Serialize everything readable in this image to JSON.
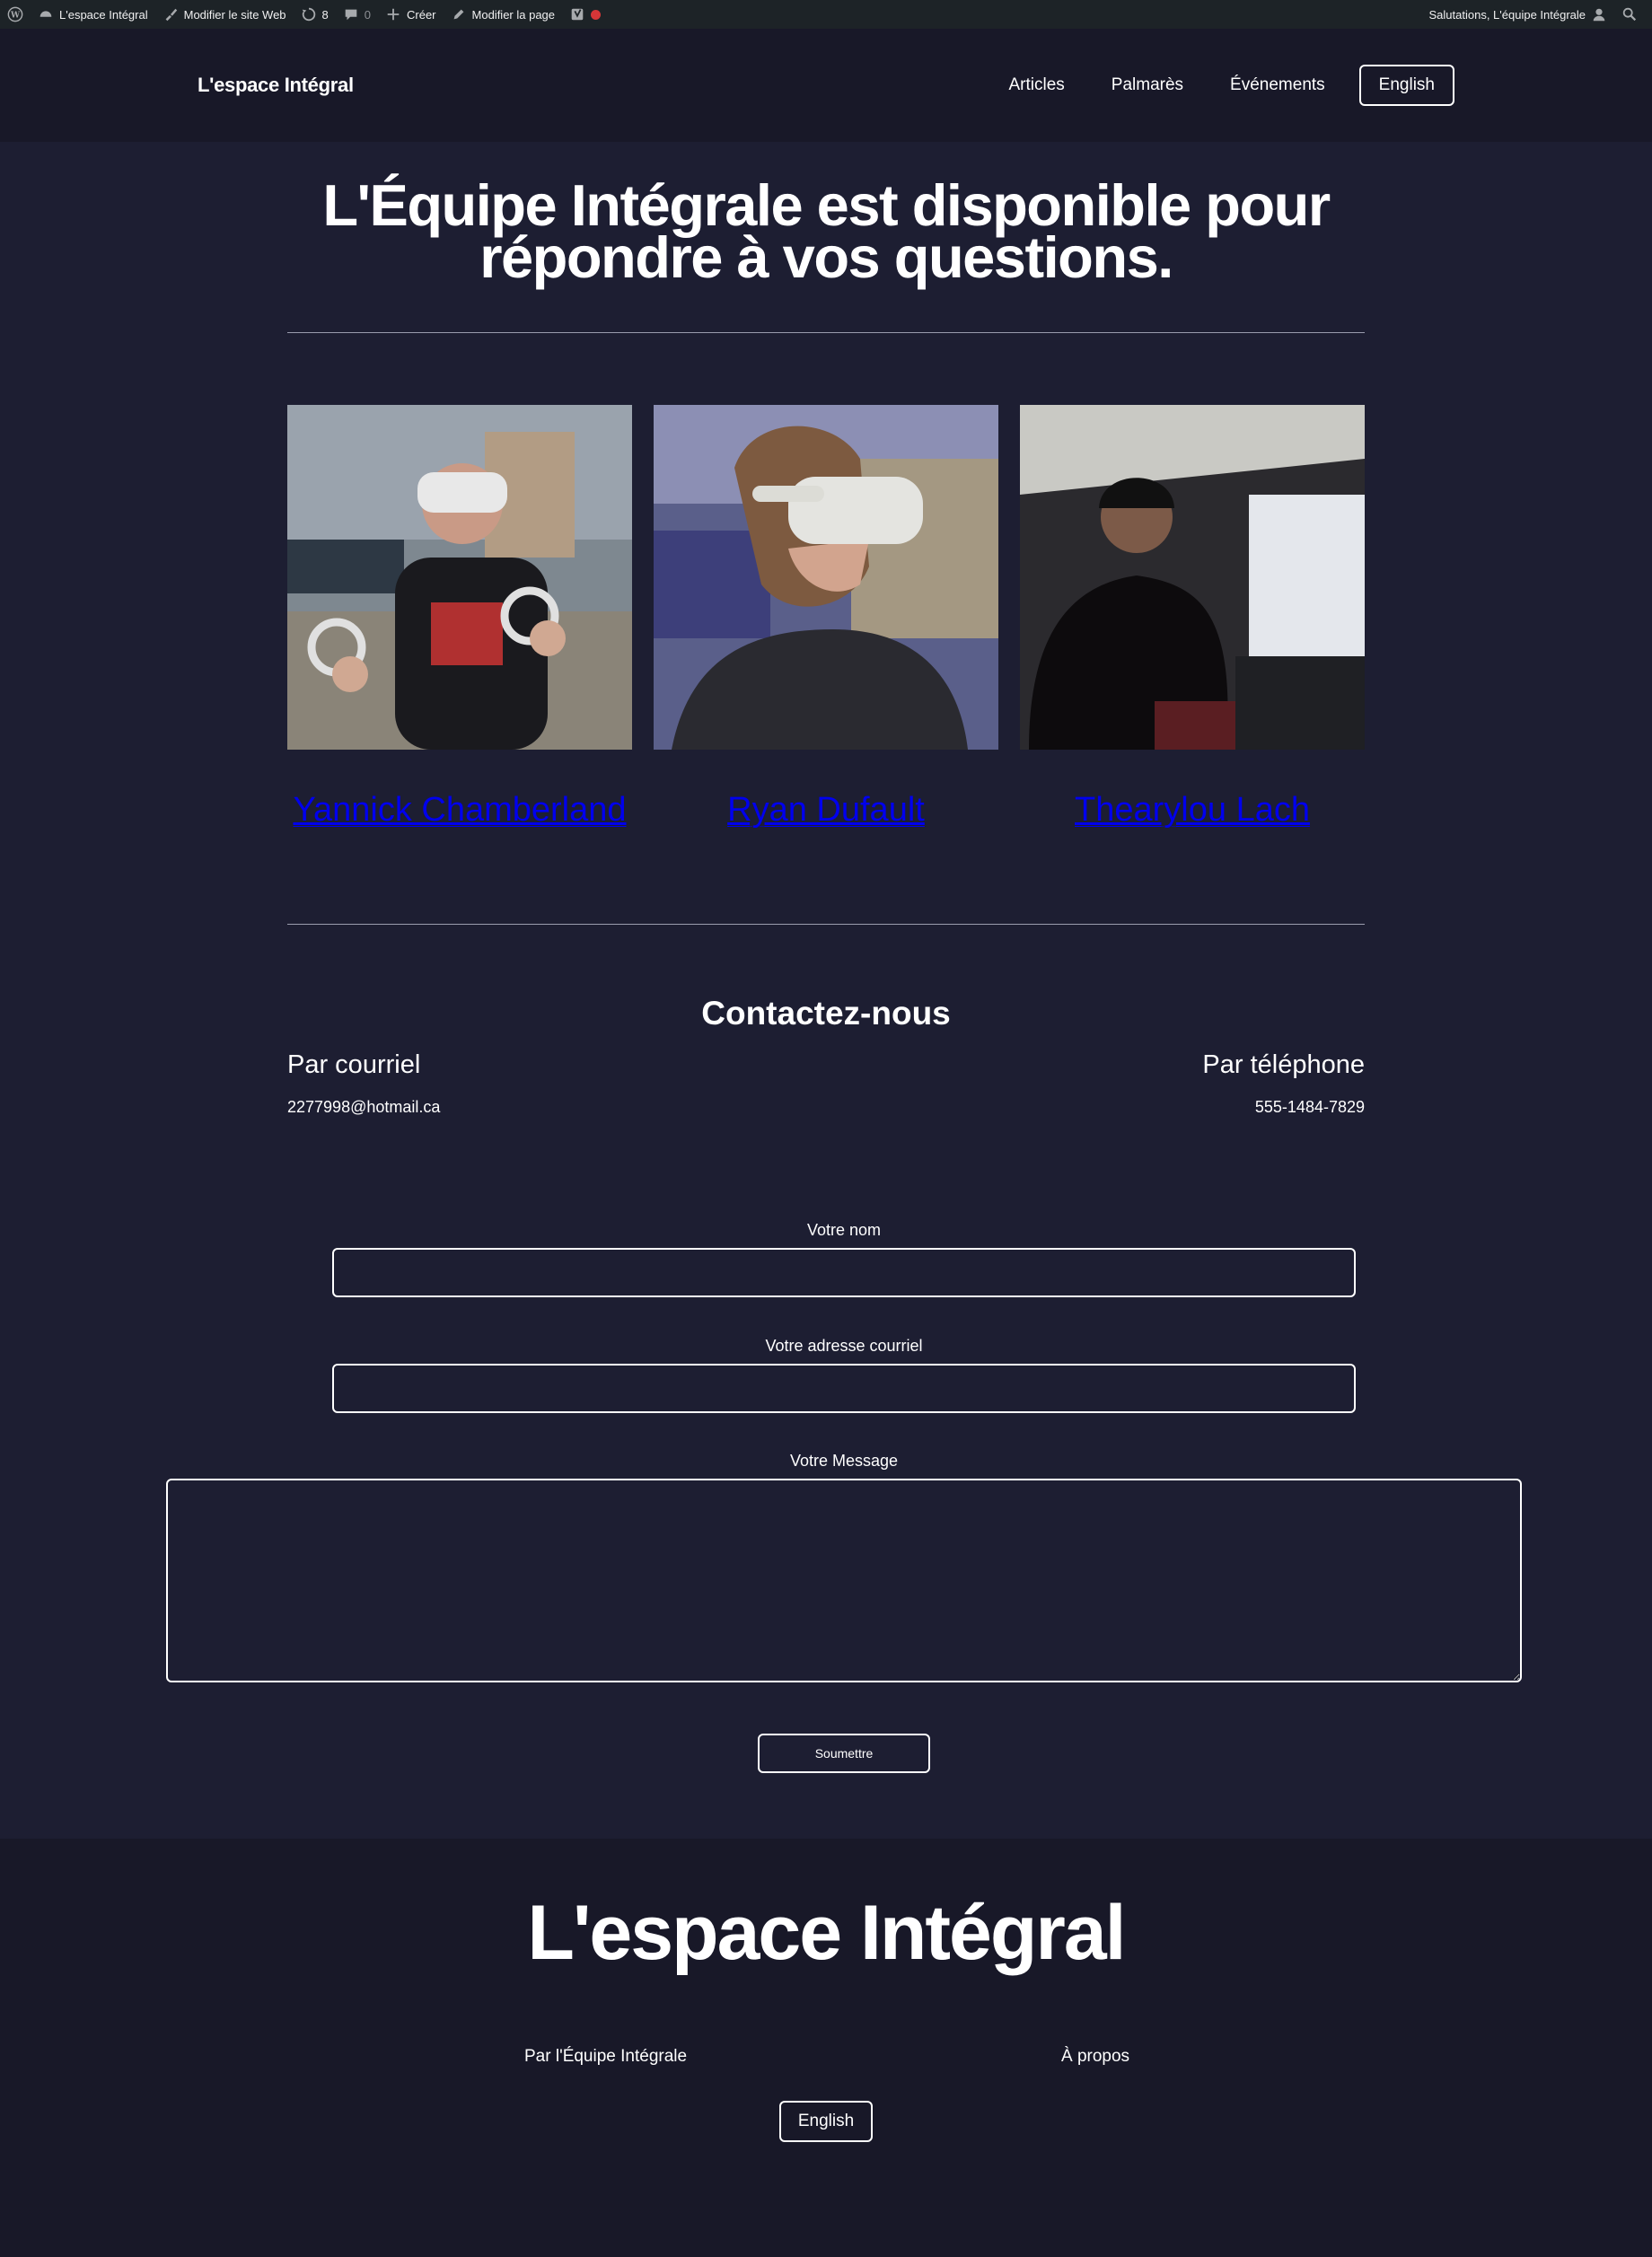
{
  "admin_bar": {
    "site_name": "L'espace Intégral",
    "edit_site": "Modifier le site Web",
    "updates_count": "8",
    "comments_count": "0",
    "create": "Créer",
    "edit_page": "Modifier la page",
    "greeting": "Salutations, L'équipe Intégrale"
  },
  "header": {
    "brand": "L'espace Intégral",
    "nav": [
      "Articles",
      "Palmarès",
      "Événements"
    ],
    "language_button": "English"
  },
  "hero": {
    "title": "L'Équipe Intégrale est disponible pour répondre à vos questions."
  },
  "team": [
    {
      "name": "Yannick Chamberland",
      "photo": "person-vr-headset-controllers"
    },
    {
      "name": "Ryan Dufault",
      "photo": "person-vr-headset-profile"
    },
    {
      "name": "Thearylou Lach",
      "photo": "person-dark-room"
    }
  ],
  "contact": {
    "title": "Contactez-nous",
    "email_heading": "Par courriel",
    "email": "2277998@hotmail.ca",
    "phone_heading": "Par téléphone",
    "phone": "555-1484-7829"
  },
  "form": {
    "name_label": "Votre nom",
    "email_label": "Votre adresse courriel",
    "message_label": "Votre Message",
    "submit": "Soumettre"
  },
  "footer": {
    "brand": "L'espace Intégral",
    "by_line": "Par l'Équipe Intégrale",
    "about": "À propos",
    "language_button": "English"
  },
  "colors": {
    "background": "#1d1e32",
    "header_background": "#181828",
    "admin_bar": "#1d2327",
    "text": "#ffffff"
  }
}
